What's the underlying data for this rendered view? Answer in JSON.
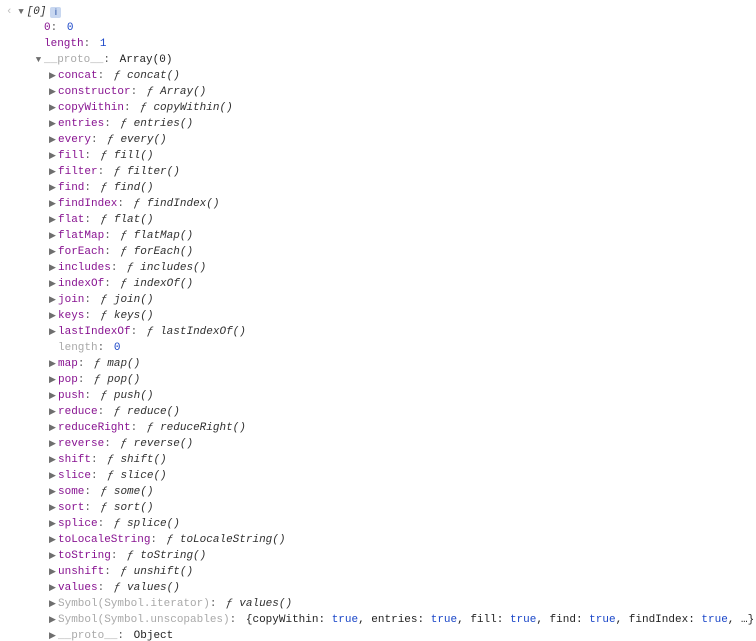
{
  "top": {
    "chevron": "‹",
    "array_label": "[0]",
    "info_badge": "i"
  },
  "own": [
    {
      "key": "0",
      "value": "0"
    },
    {
      "key": "length",
      "value": "1"
    }
  ],
  "proto_line": {
    "key": "__proto__",
    "value": "Array(0)"
  },
  "methods": [
    {
      "key": "concat",
      "fn": "concat()"
    },
    {
      "key": "constructor",
      "fn": "Array()"
    },
    {
      "key": "copyWithin",
      "fn": "copyWithin()"
    },
    {
      "key": "entries",
      "fn": "entries()"
    },
    {
      "key": "every",
      "fn": "every()"
    },
    {
      "key": "fill",
      "fn": "fill()"
    },
    {
      "key": "filter",
      "fn": "filter()"
    },
    {
      "key": "find",
      "fn": "find()"
    },
    {
      "key": "findIndex",
      "fn": "findIndex()"
    },
    {
      "key": "flat",
      "fn": "flat()"
    },
    {
      "key": "flatMap",
      "fn": "flatMap()"
    },
    {
      "key": "forEach",
      "fn": "forEach()"
    },
    {
      "key": "includes",
      "fn": "includes()"
    },
    {
      "key": "indexOf",
      "fn": "indexOf()"
    },
    {
      "key": "join",
      "fn": "join()"
    },
    {
      "key": "keys",
      "fn": "keys()"
    },
    {
      "key": "lastIndexOf",
      "fn": "lastIndexOf()"
    }
  ],
  "length_line": {
    "key": "length",
    "value": "0"
  },
  "methods2": [
    {
      "key": "map",
      "fn": "map()"
    },
    {
      "key": "pop",
      "fn": "pop()"
    },
    {
      "key": "push",
      "fn": "push()"
    },
    {
      "key": "reduce",
      "fn": "reduce()"
    },
    {
      "key": "reduceRight",
      "fn": "reduceRight()"
    },
    {
      "key": "reverse",
      "fn": "reverse()"
    },
    {
      "key": "shift",
      "fn": "shift()"
    },
    {
      "key": "slice",
      "fn": "slice()"
    },
    {
      "key": "some",
      "fn": "some()"
    },
    {
      "key": "sort",
      "fn": "sort()"
    },
    {
      "key": "splice",
      "fn": "splice()"
    },
    {
      "key": "toLocaleString",
      "fn": "toLocaleString()"
    },
    {
      "key": "toString",
      "fn": "toString()"
    },
    {
      "key": "unshift",
      "fn": "unshift()"
    },
    {
      "key": "values",
      "fn": "values()"
    }
  ],
  "symbol_iterator": {
    "key": "Symbol(Symbol.iterator)",
    "fn": "values()"
  },
  "symbol_unscopables": {
    "key": "Symbol(Symbol.unscopables)",
    "preview_pairs": [
      {
        "k": "copyWithin",
        "v": "true"
      },
      {
        "k": "entries",
        "v": "true"
      },
      {
        "k": "fill",
        "v": "true"
      },
      {
        "k": "find",
        "v": "true"
      },
      {
        "k": "findIndex",
        "v": "true"
      }
    ],
    "ellipsis": ", …}"
  },
  "proto2": {
    "key": "__proto__",
    "value": "Object"
  },
  "glyphs": {
    "f": "ƒ",
    "down": "▼",
    "right": "▶"
  }
}
